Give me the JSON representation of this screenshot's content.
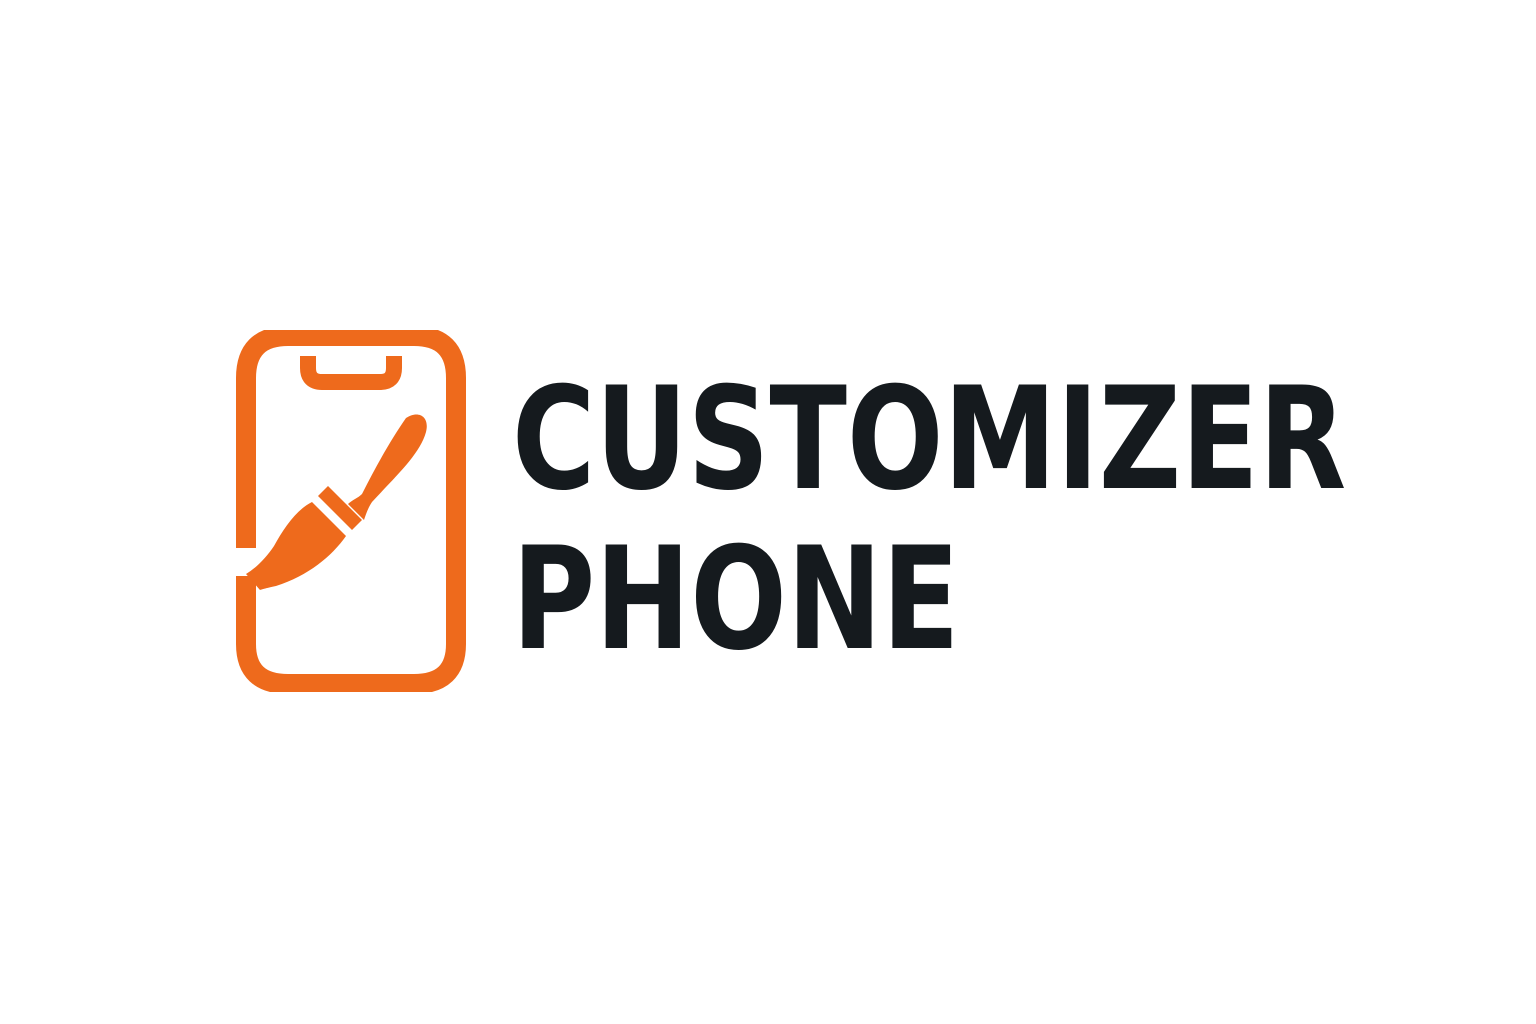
{
  "brand": {
    "line1": "CUSTOMIZER",
    "line2": "PHONE",
    "icon": "phone-paintbrush-icon",
    "colors": {
      "accent": "#EE6A1C",
      "text": "#151A1E",
      "background": "#FFFFFF"
    }
  }
}
